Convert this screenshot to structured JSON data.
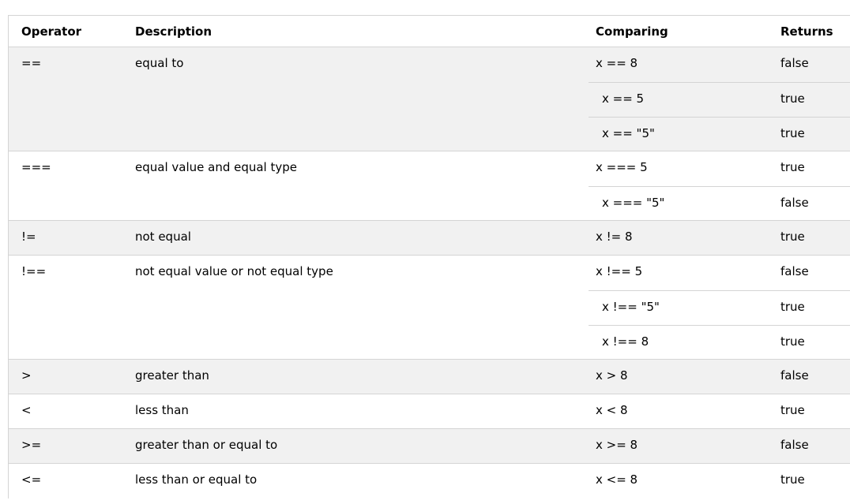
{
  "columns": [
    "Operator",
    "Description",
    "Comparing",
    "Returns"
  ],
  "rows": [
    {
      "operator": "==",
      "description": "equal to",
      "comparisons": [
        {
          "expr": "x == 8",
          "returns": "false"
        },
        {
          "expr": "x == 5",
          "returns": "true"
        },
        {
          "expr": "x == \"5\"",
          "returns": "true"
        }
      ]
    },
    {
      "operator": "===",
      "description": "equal value and equal type",
      "comparisons": [
        {
          "expr": "x === 5",
          "returns": "true"
        },
        {
          "expr": "x === \"5\"",
          "returns": "false"
        }
      ]
    },
    {
      "operator": "!=",
      "description": "not equal",
      "comparisons": [
        {
          "expr": "x != 8",
          "returns": "true"
        }
      ]
    },
    {
      "operator": "!==",
      "description": "not equal value or not equal type",
      "comparisons": [
        {
          "expr": "x !== 5",
          "returns": "false"
        },
        {
          "expr": "x !== \"5\"",
          "returns": "true"
        },
        {
          "expr": "x !== 8",
          "returns": "true"
        }
      ]
    },
    {
      "operator": ">",
      "description": "greater than",
      "comparisons": [
        {
          "expr": "x > 8",
          "returns": "false"
        }
      ]
    },
    {
      "operator": "<",
      "description": "less than",
      "comparisons": [
        {
          "expr": "x < 8",
          "returns": "true"
        }
      ]
    },
    {
      "operator": ">=",
      "description": "greater than or equal to",
      "comparisons": [
        {
          "expr": "x >= 8",
          "returns": "false"
        }
      ]
    },
    {
      "operator": "<=",
      "description": "less than or equal to",
      "comparisons": [
        {
          "expr": "x <= 8",
          "returns": "true"
        }
      ]
    }
  ]
}
